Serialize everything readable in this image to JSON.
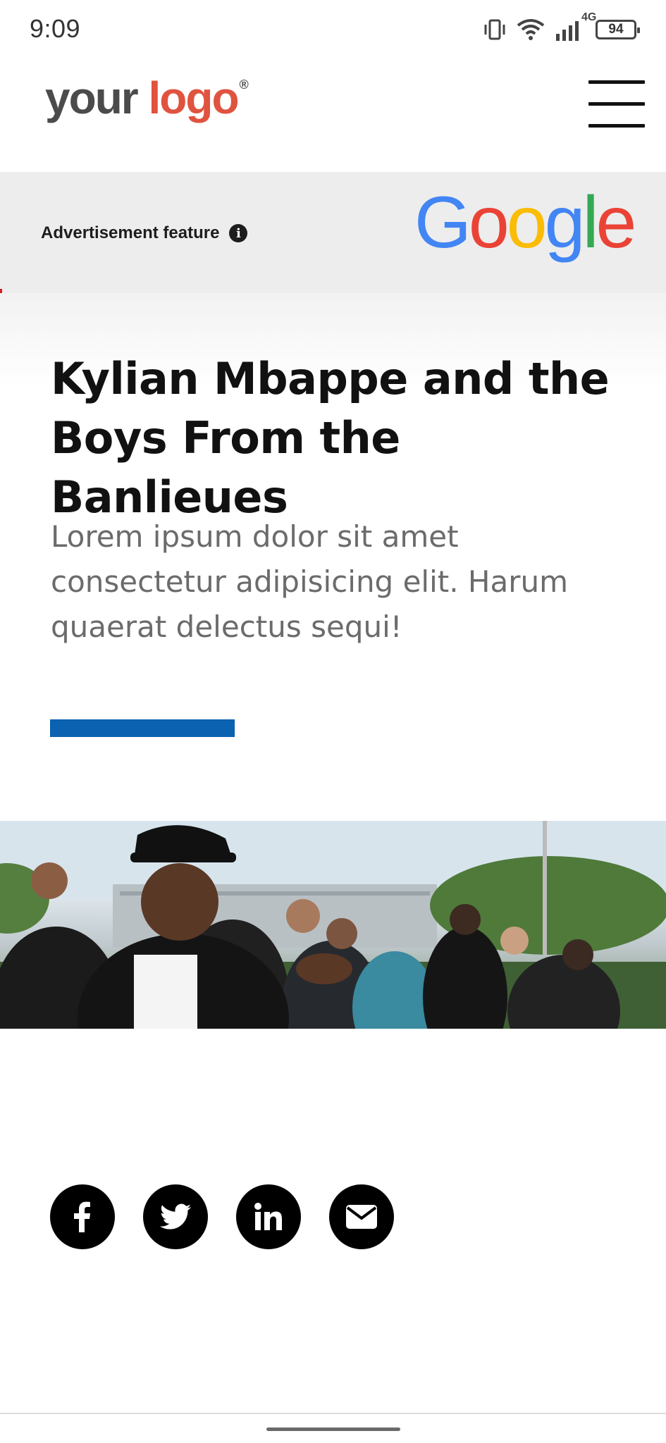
{
  "status_bar": {
    "time": "9:09",
    "network": "4G",
    "battery": "94",
    "icons": [
      "vibrate-icon",
      "wifi-icon",
      "signal-icon",
      "battery-icon"
    ]
  },
  "header": {
    "logo_your": "your",
    "logo_logo": "logo",
    "logo_reg": "®",
    "menu_icon": "hamburger-menu-icon"
  },
  "ad_banner": {
    "label": "Advertisement feature",
    "info_icon": "i",
    "sponsor": {
      "g1": "G",
      "o1": "o",
      "o2": "o",
      "g2": "g",
      "l": "l",
      "e": "e"
    }
  },
  "article": {
    "title": "Kylian Mbappe and the Boys From the Banlieues",
    "lede": "Lorem ipsum dolor sit amet consectetur adipisicing elit. Harum quaerat delectus sequi!",
    "accent_color": "#0a62b1"
  },
  "share": {
    "items": [
      {
        "name": "facebook",
        "icon": "facebook-icon"
      },
      {
        "name": "twitter",
        "icon": "twitter-icon"
      },
      {
        "name": "linkedin",
        "icon": "linkedin-icon"
      },
      {
        "name": "email",
        "icon": "email-icon"
      }
    ]
  },
  "colors": {
    "logo_gray": "#4b4b4b",
    "logo_red": "#e0533f",
    "banner_bg": "#ededed",
    "accent_blue": "#0a62b1"
  }
}
